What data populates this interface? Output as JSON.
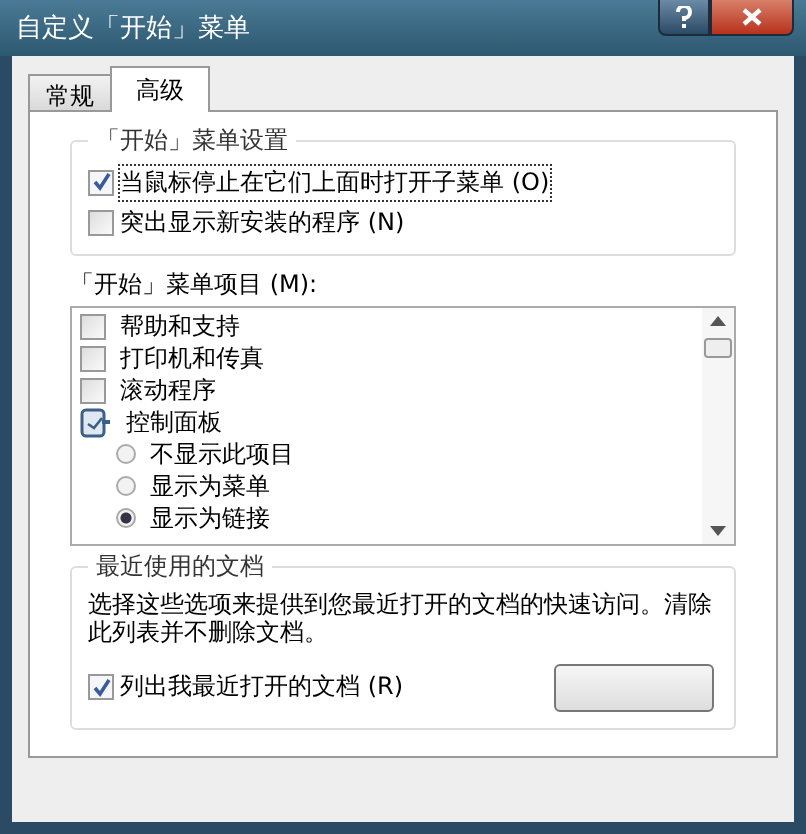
{
  "window": {
    "title": "自定义「开始」菜单"
  },
  "tabs": [
    {
      "label": "常规",
      "selected": false
    },
    {
      "label": "高级",
      "selected": true
    }
  ],
  "start_menu_settings": {
    "title": "「开始」菜单设置",
    "options": [
      {
        "label": "当鼠标停止在它们上面时打开子菜单",
        "accel": "(O)",
        "checked": true
      },
      {
        "label": "突出显示新安装的程序",
        "accel": "(N)",
        "checked": false
      }
    ]
  },
  "start_menu_items": {
    "label": "「开始」菜单项目",
    "accel": "(M):",
    "items": [
      {
        "kind": "checkbox",
        "label": "帮助和支持",
        "checked": false
      },
      {
        "kind": "checkbox",
        "label": "打印机和传真",
        "checked": false
      },
      {
        "kind": "checkbox",
        "label": "滚动程序",
        "checked": false
      },
      {
        "kind": "group",
        "label": "控制面板",
        "children": [
          {
            "kind": "radio",
            "label": "不显示此项目",
            "selected": false
          },
          {
            "kind": "radio",
            "label": "显示为菜单",
            "selected": false
          },
          {
            "kind": "radio",
            "label": "显示为链接",
            "selected": true
          }
        ]
      }
    ]
  },
  "recent_documents": {
    "title": "最近使用的文档",
    "description": "选择这些选项来提供到您最近打开的文档的快速访问。清除此列表并不删除文档。",
    "option": {
      "label": "列出我最近打开的文档",
      "accel": "(R)",
      "checked": true
    }
  }
}
